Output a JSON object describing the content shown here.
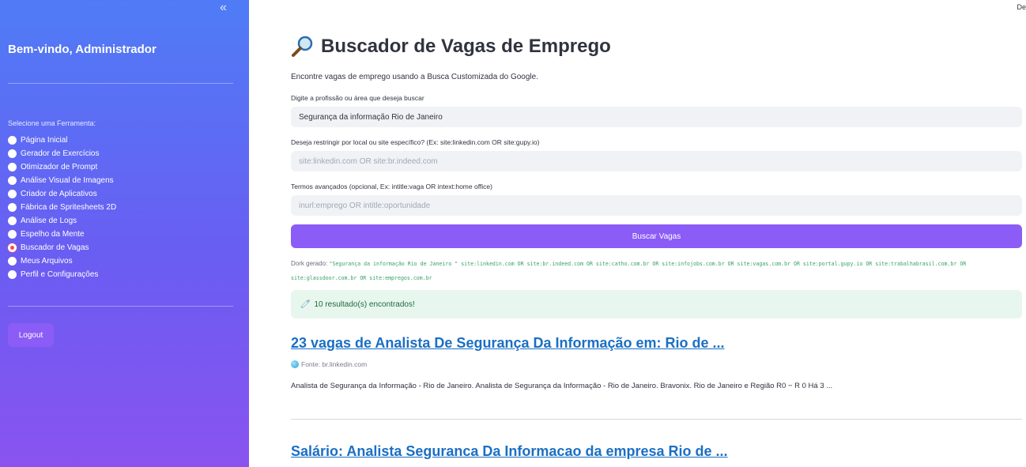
{
  "sidebar": {
    "collapse_icon": "«",
    "welcome": "Bem-vindo, Administrador",
    "select_label": "Selecione uma Ferramenta:",
    "items": [
      {
        "label": "Página Inicial",
        "selected": false
      },
      {
        "label": "Gerador de Exercícios",
        "selected": false
      },
      {
        "label": "Otimizador de Prompt",
        "selected": false
      },
      {
        "label": "Análise Visual de Imagens",
        "selected": false
      },
      {
        "label": "Criador de Aplicativos",
        "selected": false
      },
      {
        "label": "Fábrica de Spritesheets 2D",
        "selected": false
      },
      {
        "label": "Análise de Logs",
        "selected": false
      },
      {
        "label": "Espelho da Mente",
        "selected": false
      },
      {
        "label": "Buscador de Vagas",
        "selected": true
      },
      {
        "label": "Meus Arquivos",
        "selected": false
      },
      {
        "label": "Perfil e Configurações",
        "selected": false
      }
    ],
    "logout_label": "Logout"
  },
  "header": {
    "deploy_label": "De"
  },
  "main": {
    "title": "Buscador de Vagas de Emprego",
    "title_icon": "magnifying-glass-icon",
    "subtitle": "Encontre vagas de emprego usando a Busca Customizada do Google.",
    "fields": {
      "profession": {
        "label": "Digite a profissão ou área que deseja buscar",
        "value": "Segurança da informação Rio de Janeiro"
      },
      "site": {
        "label": "Deseja restringir por local ou site específico? (Ex: site:linkedin.com OR site:gupy.io)",
        "placeholder": "site:linkedin.com OR site:br.indeed.com"
      },
      "advanced": {
        "label": "Termos avançados (opcional, Ex: intitle:vaga OR intext:home office)",
        "placeholder": "inurl:emprego OR intitle:oportunidade"
      }
    },
    "search_button": "Buscar Vagas",
    "dork_label": "Dork gerado:",
    "dork_value": "\"Segurança da informação Rio de Janeiro \" site:linkedin.com OR site:br.indeed.com OR site:catho.com.br OR site:infojobs.com.br OR site:vagas.com.br OR site:portal.gupy.io OR site:trabalhabrasil.com.br OR site:glassdoor.com.br OR site:empregos.com.br",
    "success_icon": "🧷",
    "success_message": "10 resultado(s) encontrados!",
    "results": [
      {
        "title": "23 vagas de Analista De Segurança Da Informação em: Rio de ...",
        "source": "Fonte: br.linkedin.com",
        "snippet": "Analista de Segurança da Informação - Rio de Janeiro. Analista de Segurança da Informação - Rio de Janeiro. Bravonix. Rio de Janeiro e Região R0 − R 0 Há 3 ..."
      },
      {
        "title": "Salário: Analista Seguranca Da Informacao da empresa Rio de ..."
      }
    ]
  }
}
